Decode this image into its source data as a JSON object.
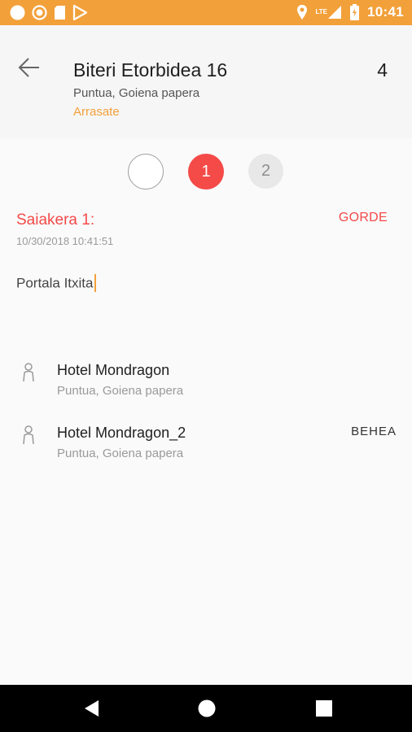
{
  "status_bar": {
    "time": "10:41",
    "network": "LTE",
    "left_icons": [
      "circle-notification-icon",
      "record-notification-icon",
      "sim-card-icon",
      "play-store-icon"
    ],
    "right_icons": [
      "location-icon",
      "signal-icon",
      "battery-icon"
    ]
  },
  "header": {
    "title": "Biteri Etorbidea 16",
    "subtitle": "Puntua, Goiena papera",
    "city": "Arrasate",
    "count": "4",
    "accent_color": "#f2a03a"
  },
  "steps": {
    "items": [
      "",
      "1",
      "2"
    ],
    "active": "1",
    "active_color": "#f44a48"
  },
  "attempt": {
    "title": "Saiakera 1:",
    "datetime": "10/30/2018 10:41:51",
    "save_label": "GORDE",
    "note_value": "Portala Itxita"
  },
  "contacts": [
    {
      "name": "Hotel Mondragon",
      "subtitle": "Puntua, Goiena papera",
      "tag": ""
    },
    {
      "name": "Hotel Mondragon_2",
      "subtitle": "Puntua, Goiena papera",
      "tag": "BEHEA"
    }
  ],
  "nav_bar": {
    "icons": [
      "back-triangle-icon",
      "home-circle-icon",
      "recents-square-icon"
    ]
  }
}
